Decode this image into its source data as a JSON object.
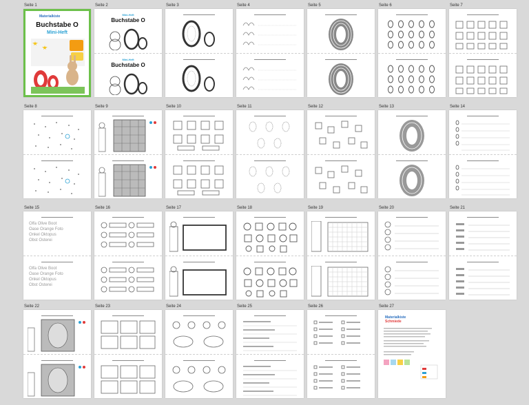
{
  "pages": [
    "Seite 1",
    "Seite 2",
    "Seite 3",
    "Seite 4",
    "Seite 5",
    "Seite 6",
    "Seite 7",
    "Seite 8",
    "Seite 9",
    "Seite 10",
    "Seite 11",
    "Seite 12",
    "Seite 13",
    "Seite 14",
    "Seite 15",
    "Seite 16",
    "Seite 17",
    "Seite 18",
    "Seite 19",
    "Seite 20",
    "Seite 21",
    "Seite 22",
    "Seite 23",
    "Seite 24",
    "Seite 25",
    "Seite 26",
    "Seite 27"
  ],
  "cover": {
    "brand": "Materialkiste",
    "title": "Buchstabe O",
    "subtitle": "Mini-Heft"
  },
  "page2": {
    "tag": "Mini-Heft",
    "title": "Buchstabe O"
  },
  "page15_words": [
    "Olfa",
    "Olive",
    "Boot",
    "Oase",
    "Orange",
    "Foto",
    "Onkel",
    "Oktopus",
    "Obst",
    "Osterei"
  ],
  "page27": {
    "brand_line1": "Materialkiste",
    "brand_line2": "Schmiede"
  },
  "colors": {
    "background": "#d9d9d9",
    "cover_green": "#6cc04a",
    "accent_blue": "#2aa1d4",
    "accent_red": "#e03a3a"
  }
}
